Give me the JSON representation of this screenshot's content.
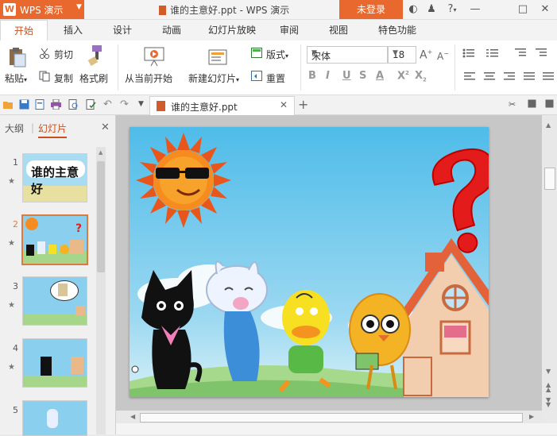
{
  "app": {
    "name": "WPS 演示",
    "window_title": "谁的主意好.ppt - WPS 演示",
    "login_label": "未登录",
    "help_label": "?"
  },
  "ribbon_tabs": [
    "开始",
    "插入",
    "设计",
    "动画",
    "幻灯片放映",
    "审阅",
    "视图",
    "特色功能"
  ],
  "ribbon": {
    "paste": "粘贴",
    "cut": "剪切",
    "copy": "复制",
    "format_painter": "格式刷",
    "from_current": "从当前开始",
    "new_slide": "新建幻灯片",
    "layout": "版式",
    "reset": "重置",
    "font_name": "宋体",
    "font_size": "18"
  },
  "document_tab": {
    "title": "谁的主意好.ppt"
  },
  "left_panel": {
    "tab_outline": "大纲",
    "tab_slides": "幻灯片",
    "slides": [
      {
        "number": "1",
        "title_text": "谁的主意好"
      },
      {
        "number": "2"
      },
      {
        "number": "3"
      },
      {
        "number": "4"
      },
      {
        "number": "5"
      }
    ]
  },
  "colors": {
    "accent": "#e9682d",
    "active_tab_text": "#c7501d",
    "sky": "#6fc6ee"
  }
}
